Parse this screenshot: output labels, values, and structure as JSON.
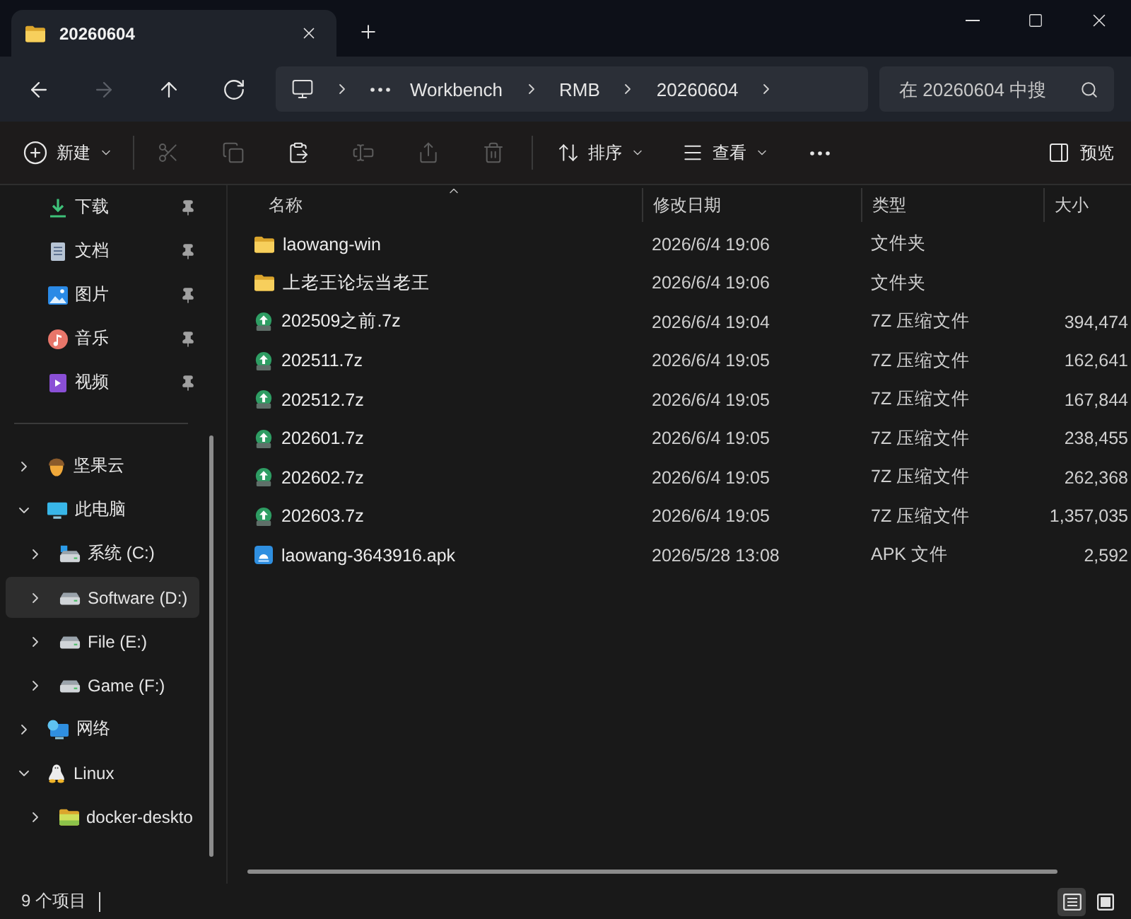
{
  "tabs": [
    {
      "label": "20260604",
      "selected": true
    }
  ],
  "navigation": [
    {
      "kind": "back",
      "disabled": false
    },
    {
      "kind": "forward",
      "disabled": true
    },
    {
      "kind": "up",
      "disabled": false
    },
    {
      "kind": "refresh",
      "disabled": false
    }
  ],
  "address_bar": {
    "segments": [
      "Workbench",
      "RMB",
      "20260604"
    ]
  },
  "search": {
    "placeholder": "在 20260604 中搜"
  },
  "toolbar": {
    "groups": [
      [
        {
          "kind": "new",
          "label": "新建",
          "menu": true,
          "disabled": false
        }
      ],
      [
        {
          "kind": "cut",
          "disabled": true
        },
        {
          "kind": "copy",
          "disabled": true
        },
        {
          "kind": "paste",
          "disabled": false
        },
        {
          "kind": "rename",
          "disabled": true
        },
        {
          "kind": "share",
          "disabled": true
        },
        {
          "kind": "delete",
          "disabled": true
        }
      ],
      [
        {
          "kind": "sort",
          "label": "排序",
          "menu": true,
          "disabled": false
        },
        {
          "kind": "view",
          "label": "查看",
          "menu": true,
          "disabled": false
        },
        {
          "kind": "more",
          "disabled": false
        }
      ]
    ],
    "preview": {
      "label": "预览"
    }
  },
  "sidebar": {
    "quick_access": [
      {
        "kind": "downloads",
        "label": "下载",
        "pinned": true
      },
      {
        "kind": "documents",
        "label": "文档",
        "pinned": true
      },
      {
        "kind": "pictures",
        "label": "图片",
        "pinned": true
      },
      {
        "kind": "music",
        "label": "音乐",
        "pinned": true
      },
      {
        "kind": "videos",
        "label": "视频",
        "pinned": true
      }
    ],
    "tree": [
      {
        "kind": "nutstore",
        "label": "坚果云",
        "expanded": false,
        "selected": false
      },
      {
        "kind": "computer",
        "label": "此电脑",
        "expanded": true,
        "selected": false,
        "children": [
          {
            "kind": "systemdrive",
            "label": "系统 (C:)",
            "expanded": false,
            "selected": false
          },
          {
            "kind": "drive",
            "label": "Software (D:)",
            "expanded": false,
            "selected": true
          },
          {
            "kind": "drive",
            "label": "File (E:)",
            "expanded": false,
            "selected": false
          },
          {
            "kind": "drive",
            "label": "Game (F:)",
            "expanded": false,
            "selected": false
          }
        ]
      },
      {
        "kind": "network",
        "label": "网络",
        "expanded": false,
        "selected": false
      },
      {
        "kind": "linux",
        "label": "Linux",
        "expanded": true,
        "selected": false,
        "children": [
          {
            "kind": "folder",
            "label": "docker-deskto",
            "expanded": false,
            "selected": false
          }
        ]
      }
    ]
  },
  "file_list": {
    "columns": [
      {
        "label": "名称",
        "sorted": true
      },
      {
        "label": "修改日期",
        "sorted": false
      },
      {
        "label": "类型",
        "sorted": false
      },
      {
        "label": "大小",
        "sorted": false
      }
    ],
    "rows": [
      {
        "kind": "folder",
        "name": "laowang-win",
        "modified": "2026/6/4 19:06",
        "type": "文件夹"
      },
      {
        "kind": "folder",
        "name": "上老王论坛当老王",
        "modified": "2026/6/4 19:06",
        "type": "文件夹"
      },
      {
        "kind": "archive",
        "name": "202509之前.7z",
        "modified": "2026/6/4 19:04",
        "type": "7Z 压缩文件",
        "size": "394,474"
      },
      {
        "kind": "archive",
        "name": "202511.7z",
        "modified": "2026/6/4 19:05",
        "type": "7Z 压缩文件",
        "size": "162,641"
      },
      {
        "kind": "archive",
        "name": "202512.7z",
        "modified": "2026/6/4 19:05",
        "type": "7Z 压缩文件",
        "size": "167,844"
      },
      {
        "kind": "archive",
        "name": "202601.7z",
        "modified": "2026/6/4 19:05",
        "type": "7Z 压缩文件",
        "size": "238,455"
      },
      {
        "kind": "archive",
        "name": "202602.7z",
        "modified": "2026/6/4 19:05",
        "type": "7Z 压缩文件",
        "size": "262,368"
      },
      {
        "kind": "archive",
        "name": "202603.7z",
        "modified": "2026/6/4 19:05",
        "type": "7Z 压缩文件",
        "size": "1,357,035"
      },
      {
        "kind": "apk",
        "name": "laowang-3643916.apk",
        "modified": "2026/5/28 13:08",
        "type": "APK 文件",
        "size": "2,592"
      }
    ]
  },
  "status_bar": {
    "item_count": "9 个项目",
    "views": [
      {
        "kind": "details",
        "selected": true
      },
      {
        "kind": "tiles",
        "selected": false
      }
    ]
  }
}
